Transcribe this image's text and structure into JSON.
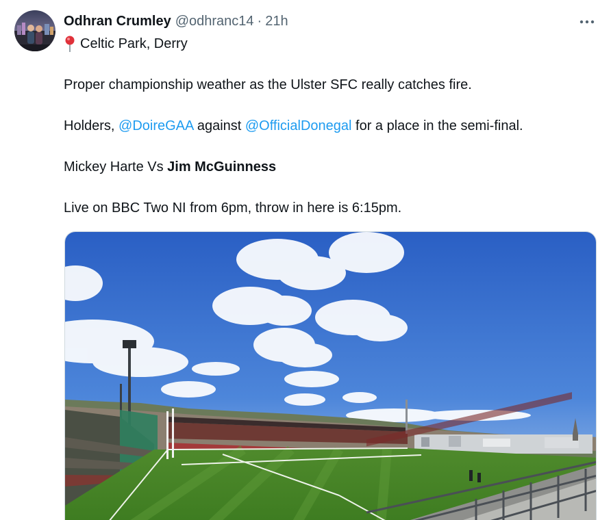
{
  "author": {
    "display_name": "Odhran Crumley",
    "handle": "@odhranc14",
    "separator": "·",
    "time": "21h",
    "avatar_icon": "avatar-photo"
  },
  "more_icon": "more-options-icon",
  "location": {
    "icon": "round-pushpin-icon",
    "text": "Celtic Park, Derry"
  },
  "tweet": {
    "line1": "Proper championship weather as the Ulster SFC really catches fire.",
    "line2_prefix": "Holders, ",
    "mention_derry": "@DoireGAA",
    "line2_mid": " against ",
    "mention_donegal": "@OfficialDonegal",
    "line2_suffix": " for a place in the semi-final.",
    "line3_prefix": "Mickey Harte Vs ",
    "line3_bold": "Jim McGuinness",
    "line4": "Live on BBC Two NI from 6pm, throw in here is 6:15pm."
  },
  "colors": {
    "mention": "#1d9bf0",
    "secondary_text": "#536471",
    "primary_text": "#0f1419"
  },
  "media": {
    "image_subject": "stadium-photo-celtic-park"
  }
}
